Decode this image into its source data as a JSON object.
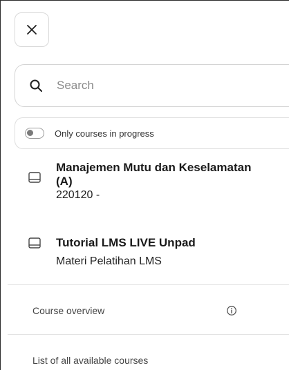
{
  "close": {
    "icon": "close-icon"
  },
  "search": {
    "placeholder": "Search",
    "value": "",
    "icon": "search-icon"
  },
  "filter": {
    "label": "Only courses in progress",
    "enabled": false
  },
  "courses": [
    {
      "title": "Manajemen Mutu dan Keselamatan (A)",
      "subtitle": "220120 -",
      "icon": "course-icon"
    },
    {
      "title": "Tutorial LMS LIVE Unpad",
      "subtitle": "Materi Pelatihan LMS",
      "icon": "course-icon"
    }
  ],
  "links": {
    "overview": {
      "label": "Course overview",
      "icon": "info-icon"
    },
    "all_courses": {
      "label": "List of all available courses"
    }
  }
}
